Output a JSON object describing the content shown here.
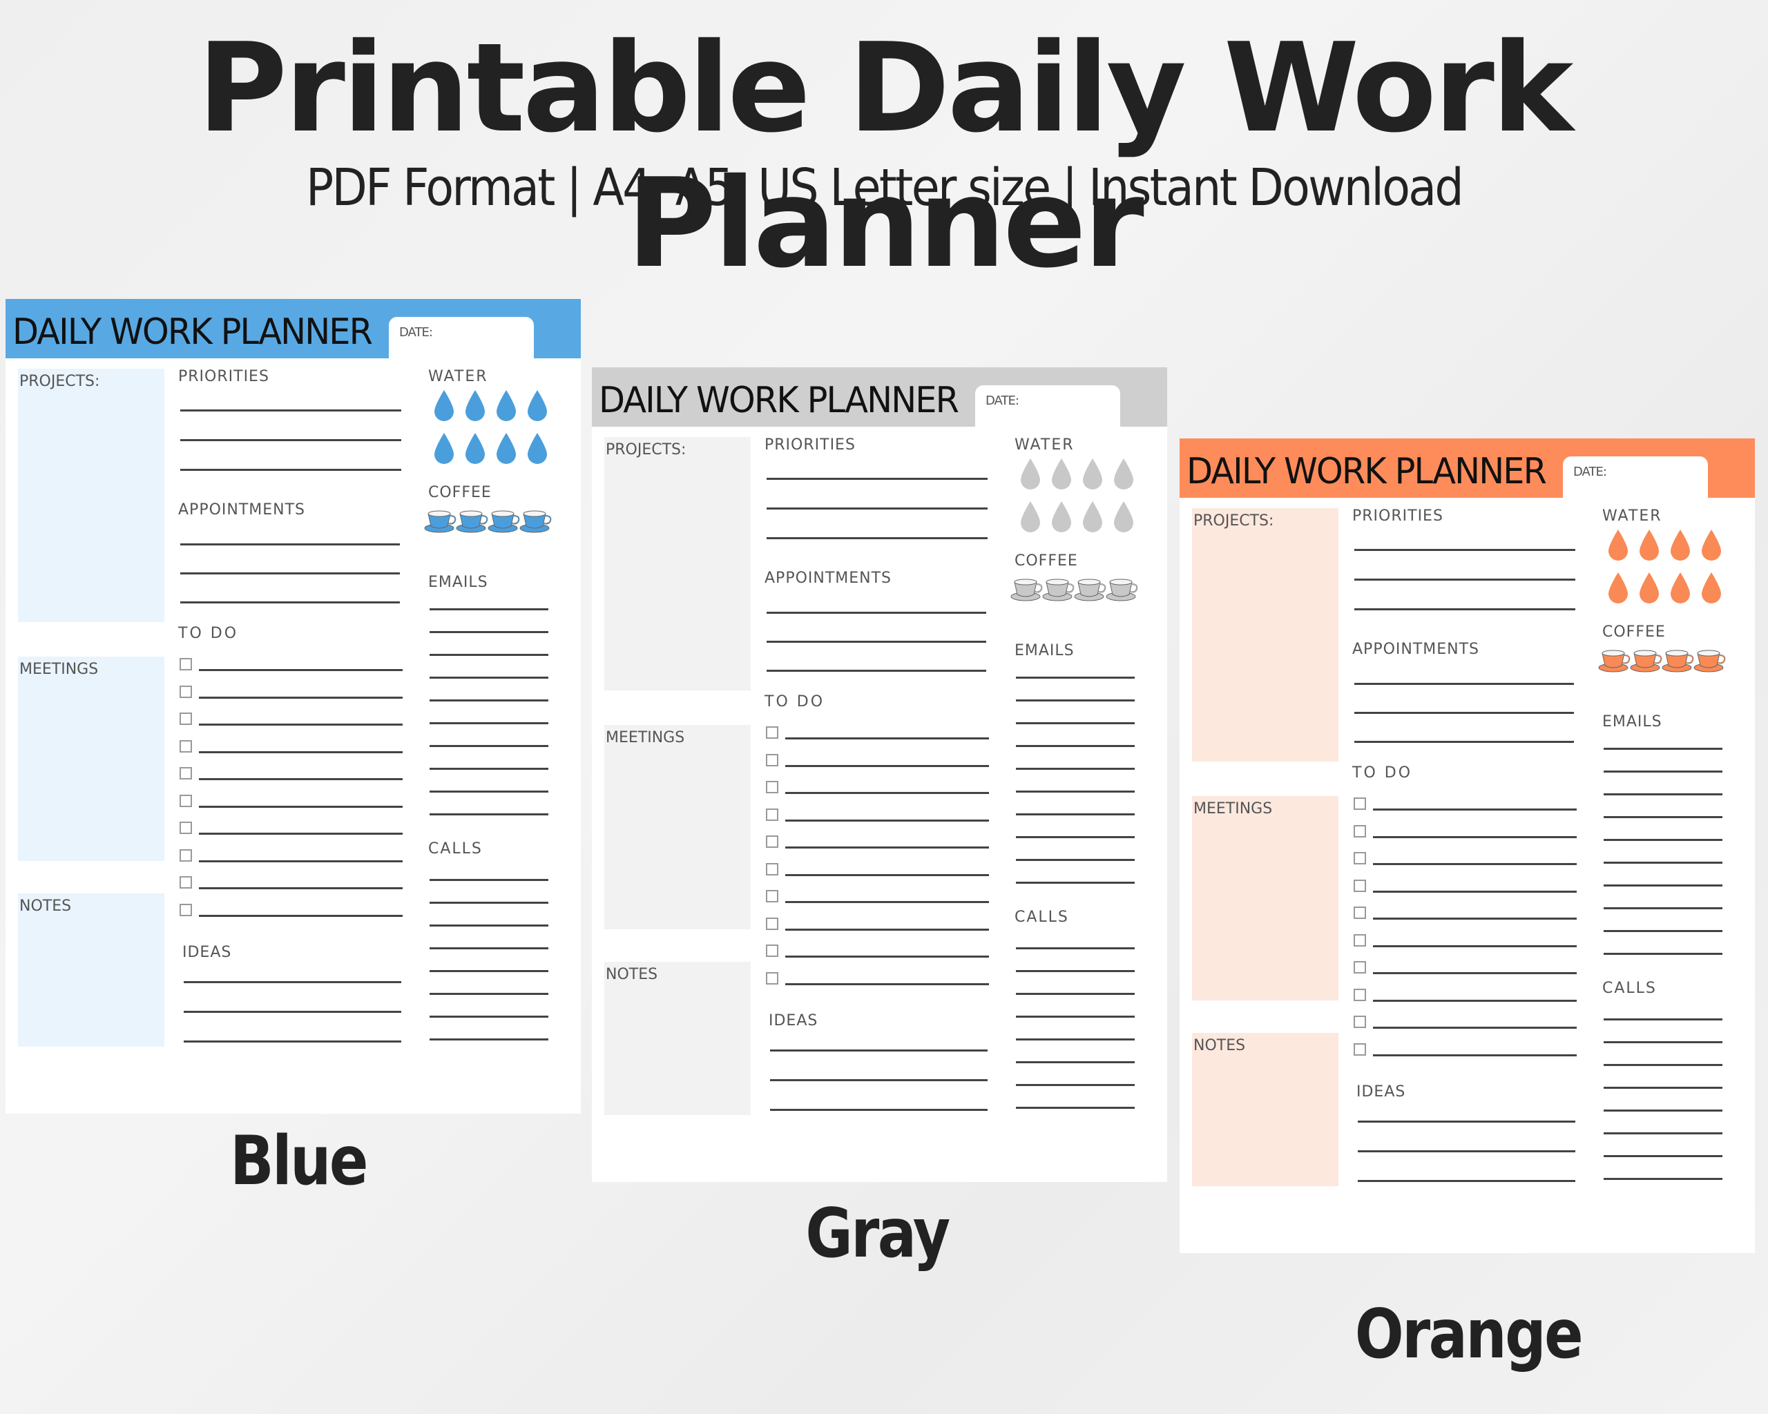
{
  "header": {
    "title": "Printable Daily Work Planner",
    "subtitle": "PDF Format | A4, A5, US Letter size | Instant Download"
  },
  "planner": {
    "title": "DAILY WORK PLANNER",
    "date_label": "DATE:",
    "sections": {
      "projects": "PROJECTS:",
      "meetings": "MEETINGS",
      "notes": "NOTES",
      "priorities": "PRIORITIES",
      "appointments": "APPOINTMENTS",
      "todo": "TO DO",
      "ideas": "IDEAS",
      "water": "WATER",
      "coffee": "COFFEE",
      "emails": "EMAILS",
      "calls": "CALLS"
    },
    "counts": {
      "priorities_lines": 3,
      "appointments_lines": 3,
      "todo_items": 10,
      "ideas_lines": 3,
      "water_drops": 8,
      "coffee_cups": 4,
      "emails_lines": 10,
      "calls_lines": 8
    }
  },
  "variants": [
    {
      "name": "Blue",
      "accent": "#58a9e3",
      "light": "#eaf4fd",
      "icon": "#4a9edc"
    },
    {
      "name": "Gray",
      "accent": "#cfcfcf",
      "light": "#f2f2f2",
      "icon": "#c8c8c8"
    },
    {
      "name": "Orange",
      "accent": "#fe8c5a",
      "light": "#fde8de",
      "icon": "#f98a55"
    }
  ]
}
